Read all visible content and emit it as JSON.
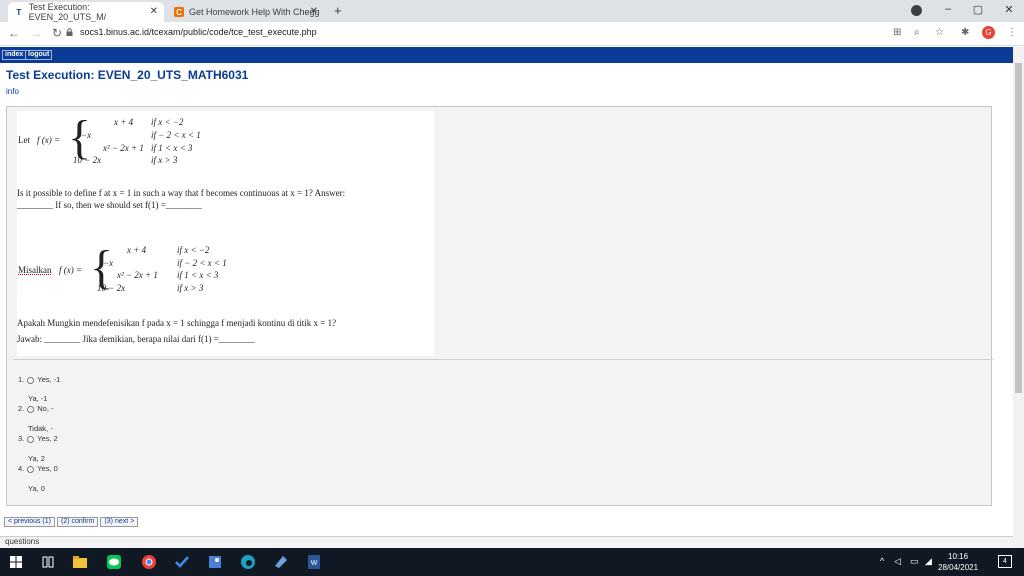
{
  "browser": {
    "tabs": [
      {
        "title": "Test Execution: EVEN_20_UTS_M/",
        "favicon": "T",
        "active": true
      },
      {
        "title": "Get Homework Help With Chegg",
        "favicon": "C",
        "active": false
      }
    ],
    "new_tab": "+",
    "url": "socs1.binus.ac.id/tcexam/public/code/tce_test_execute.php",
    "profile_initial": "G"
  },
  "page": {
    "nav": {
      "index": "index",
      "logout": "logout"
    },
    "title": "Test Execution: EVEN_20_UTS_MATH6031",
    "info": "info"
  },
  "question": {
    "english": {
      "let": "Let",
      "fx": "f (x) =",
      "cases": [
        {
          "expr": "x + 4",
          "cond": "if  x < −2"
        },
        {
          "expr": "−x",
          "cond": "if − 2 < x < 1"
        },
        {
          "expr": "x² − 2x + 1",
          "cond": "if   1 < x < 3"
        },
        {
          "expr": "10 − 2x",
          "cond": "if x > 3"
        }
      ],
      "line1": "Is it possible to define f at x = 1 in such a way that f becomes continuous at x = 1? Answer:",
      "line2": "________  If so, then we should set f(1) =________"
    },
    "indonesian": {
      "let": "Misalkan",
      "fx": "f (x) =",
      "cases": [
        {
          "expr": "x + 4",
          "cond": "if  x < −2"
        },
        {
          "expr": "−x",
          "cond": "if − 2 < x < 1"
        },
        {
          "expr": "x² − 2x + 1",
          "cond": "if   1 < x < 3"
        },
        {
          "expr": "10 − 2x",
          "cond": "if x > 3"
        }
      ],
      "line1": "Apakah Mungkin mendefenisikan f pada x = 1 schingga f menjadi kontinu di titik  x = 1?",
      "line2": "Jawab: ________   Jika demikian, berapa nilai dari  f(1) =________"
    }
  },
  "options": [
    {
      "num": "1.",
      "label": "Yes, -1",
      "sub": "Ya, -1"
    },
    {
      "num": "2.",
      "label": "No, -",
      "sub": "Tidak, -"
    },
    {
      "num": "3.",
      "label": "Yes, 2",
      "sub": "Ya, 2"
    },
    {
      "num": "4.",
      "label": "Yes, 0",
      "sub": "Ya, 0"
    }
  ],
  "buttons": {
    "previous": "< previous (1)",
    "confirm": "(2) confirm",
    "next": "(3) next >"
  },
  "footer": {
    "questions": "questions"
  },
  "taskbar": {
    "time": "10:16",
    "date": "28/04/2021",
    "notif_count": "4"
  }
}
